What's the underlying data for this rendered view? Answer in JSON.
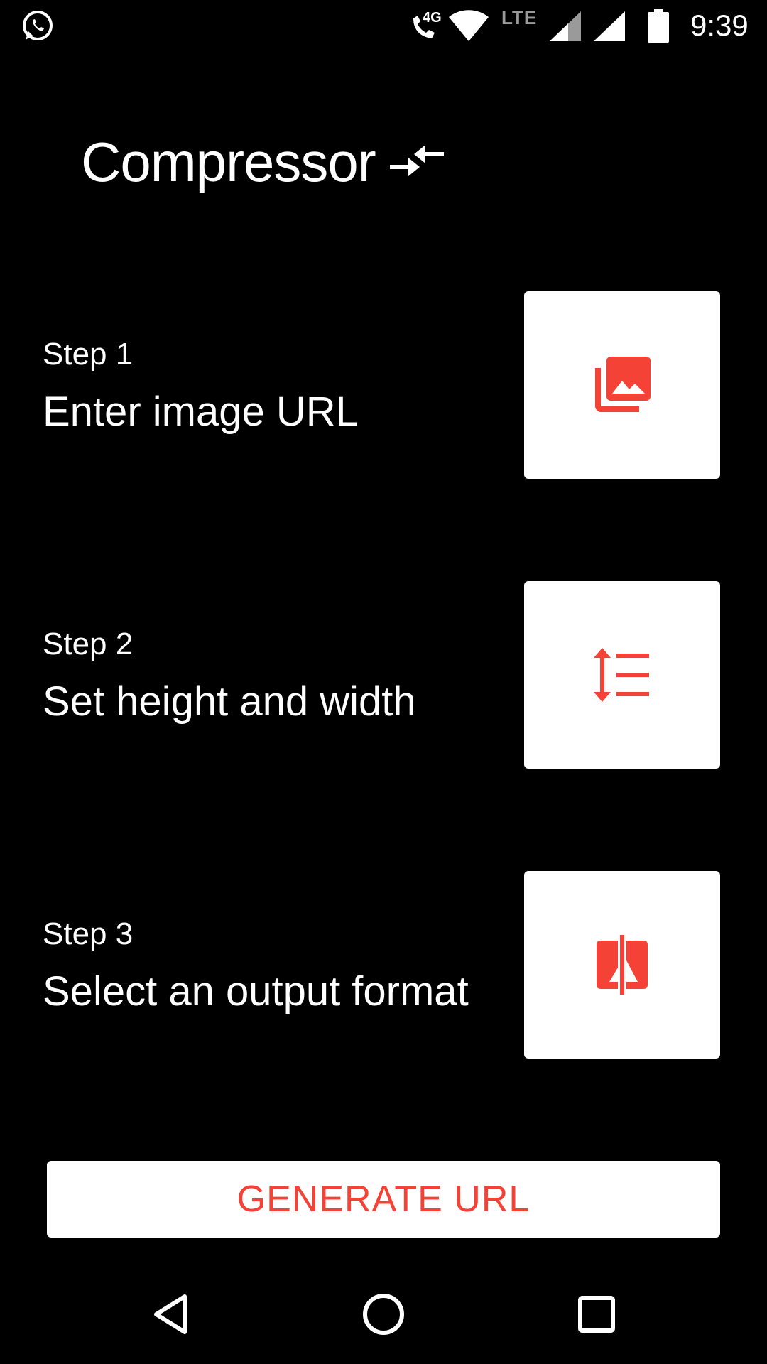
{
  "status_bar": {
    "network_badge": "4G",
    "network_type": "LTE",
    "time": "9:39",
    "icons": [
      "whatsapp-icon",
      "wifi-calling-icon",
      "wifi-icon",
      "signal-icon",
      "battery-icon"
    ]
  },
  "app": {
    "title": "Compressor",
    "title_icon": "compress-arrows-icon"
  },
  "steps": [
    {
      "number": "Step 1",
      "description": "Enter image URL",
      "icon": "photo-library-icon"
    },
    {
      "number": "Step 2",
      "description": "Set height and width",
      "icon": "line-height-icon"
    },
    {
      "number": "Step 3",
      "description": "Select an output format",
      "icon": "compare-icon"
    }
  ],
  "actions": {
    "generate_label": "GENERATE URL"
  },
  "nav_bar": {
    "icons": [
      "back-icon",
      "home-icon",
      "recent-apps-icon"
    ]
  },
  "colors": {
    "background": "#000000",
    "card": "#ffffff",
    "accent": "#f44336",
    "text": "#ffffff"
  }
}
